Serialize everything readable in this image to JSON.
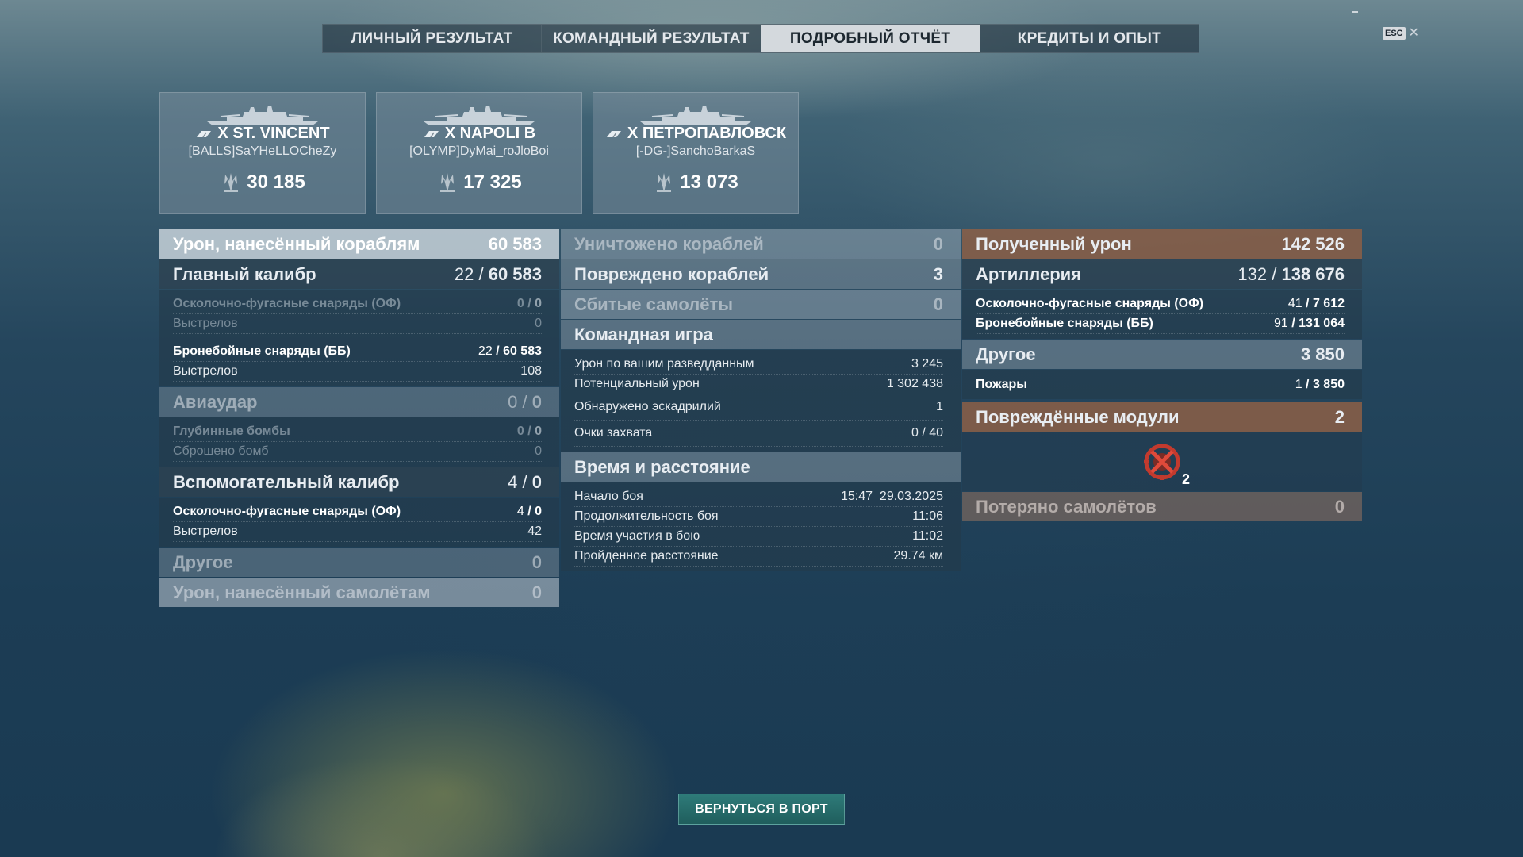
{
  "tabs": [
    {
      "label": "ЛИЧНЫЙ РЕЗУЛЬТАТ"
    },
    {
      "label": "КОМАНДНЫЙ РЕЗУЛЬТАТ"
    },
    {
      "label": "ПОДРОБНЫЙ ОТЧЁТ",
      "active": true
    },
    {
      "label": "КРЕДИТЫ И ОПЫТ"
    }
  ],
  "esc": {
    "key": "ESC",
    "close": "✕"
  },
  "ships": [
    {
      "name": "X ST. VINCENT",
      "player": "[BALLS]SaYHeLLOCheZy",
      "damage": "30 185"
    },
    {
      "name": "X NAPOLI B",
      "player": "[OLYMP]DyMai_roJloBoi",
      "damage": "17 325"
    },
    {
      "name": "X ПЕТРОПАВЛОВСК",
      "player": "[-DG-]SanchoBarkaS",
      "damage": "13 073"
    }
  ],
  "left": {
    "dmg_ships": {
      "label": "Урон, нанесённый кораблям",
      "value": "60 583"
    },
    "main_caliber": {
      "label": "Главный калибр",
      "a": "22",
      "b": "60 583"
    },
    "he": {
      "label": "Осколочно-фугасные снаряды (ОФ)",
      "a": "0",
      "b": "0"
    },
    "he_shots": {
      "label": "Выстрелов",
      "value": "0"
    },
    "ap": {
      "label": "Бронебойные снаряды (ББ)",
      "a": "22",
      "b": "60 583"
    },
    "ap_shots": {
      "label": "Выстрелов",
      "value": "108"
    },
    "airstrike": {
      "label": "Авиаудар",
      "a": "0",
      "b": "0"
    },
    "depth": {
      "label": "Глубинные бомбы",
      "a": "0",
      "b": "0"
    },
    "bombs": {
      "label": "Сброшено бомб",
      "value": "0"
    },
    "secondary": {
      "label": "Вспомогательный калибр",
      "a": "4",
      "b": "0"
    },
    "sec_he": {
      "label": "Осколочно-фугасные снаряды (ОФ)",
      "a": "4",
      "b": "0"
    },
    "sec_shots": {
      "label": "Выстрелов",
      "value": "42"
    },
    "other": {
      "label": "Другое",
      "value": "0"
    },
    "dmg_planes": {
      "label": "Урон, нанесённый самолётам",
      "value": "0"
    }
  },
  "middle": {
    "destroyed": {
      "label": "Уничтожено кораблей",
      "value": "0"
    },
    "damaged": {
      "label": "Повреждено кораблей",
      "value": "3"
    },
    "planes": {
      "label": "Сбитые самолёты",
      "value": "0"
    },
    "team": {
      "label": "Командная игра"
    },
    "spotting": {
      "label": "Урон по вашим разведданным",
      "value": "3 245"
    },
    "potential": {
      "label": "Потенциальный урон",
      "value": "1 302 438"
    },
    "squadrons": {
      "label": "Обнаружено эскадрилий",
      "value": "1"
    },
    "capture": {
      "label": "Очки захвата",
      "value": "0 / 40"
    },
    "time": {
      "label": "Время и расстояние"
    },
    "start": {
      "label": "Начало боя",
      "value": "15:47  29.03.2025"
    },
    "duration": {
      "label": "Продолжительность боя",
      "value": "11:06"
    },
    "participation": {
      "label": "Время участия в бою",
      "value": "11:02"
    },
    "distance": {
      "label": "Пройденное расстояние",
      "value": "29.74 км"
    }
  },
  "right": {
    "received": {
      "label": "Полученный урон",
      "value": "142 526"
    },
    "artillery": {
      "label": "Артиллерия",
      "a": "132",
      "b": "138 676"
    },
    "he": {
      "label": "Осколочно-фугасные снаряды (ОФ)",
      "a": "41",
      "b": "7 612"
    },
    "ap": {
      "label": "Бронебойные снаряды (ББ)",
      "a": "91",
      "b": "131 064"
    },
    "other": {
      "label": "Другое",
      "value": "3 850"
    },
    "fires": {
      "label": "Пожары",
      "a": "1",
      "b": "3 850"
    },
    "modules": {
      "label": "Повреждённые модули",
      "value": "2"
    },
    "module_icon_count": "2",
    "lost_planes": {
      "label": "Потеряно самолётов",
      "value": "0"
    }
  },
  "back_button": "ВЕРНУТЬСЯ В ПОРТ",
  "colors": {
    "active_tab": "#d4d9dd",
    "brown_header": "#8c5f46",
    "button": "#2e7b79"
  }
}
